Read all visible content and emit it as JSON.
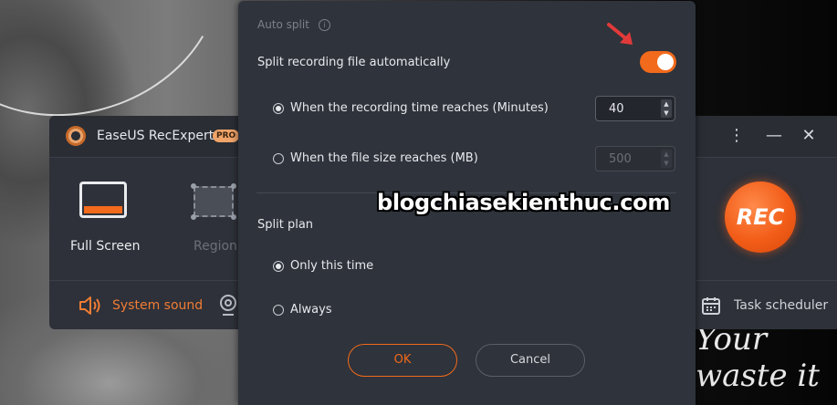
{
  "app": {
    "title": "EaseUS RecExperts",
    "badge": "PRO",
    "modes": [
      {
        "label": "Full Screen",
        "active": true
      },
      {
        "label": "Region",
        "active": false
      }
    ],
    "bottom": {
      "sound_label": "System sound",
      "task_label": "Task scheduler"
    },
    "rec_label": "REC",
    "colors": {
      "accent": "#f26a1b",
      "window": "#2e3139"
    }
  },
  "dialog": {
    "header": "Auto split",
    "split_auto_label": "Split recording file automatically",
    "split_auto_enabled": true,
    "options": [
      {
        "label": "When the recording time reaches (Minutes)",
        "selected": true,
        "value": "40",
        "enabled": true
      },
      {
        "label": "When the file size reaches (MB)",
        "selected": false,
        "value": "500",
        "enabled": false
      }
    ],
    "plan_label": "Split plan",
    "plan_options": [
      {
        "label": "Only this time",
        "selected": true
      },
      {
        "label": "Always",
        "selected": false
      }
    ],
    "ok_label": "OK",
    "cancel_label": "Cancel"
  },
  "watermark": "blogchiasekienthuc.com",
  "background_script": "Your\nwaste it"
}
